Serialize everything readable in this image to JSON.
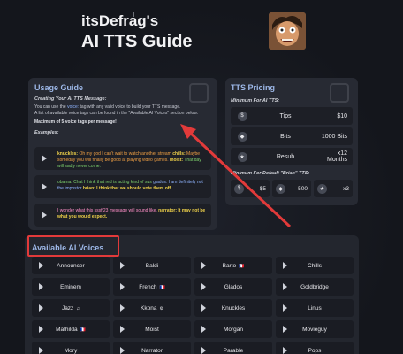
{
  "header": {
    "title_line1": "itsDefrag's",
    "title_line2": "AI TTS Guide"
  },
  "usage": {
    "title": "Usage Guide",
    "subtitle": "Creating Your AI TTS Message:",
    "p1_a": "You can use the ",
    "p1_voice": "voice:",
    "p1_b": " tag with any valid voice to build your TTS message.",
    "p2": "A list of available voice tags can be found in the \"Available AI Voices\" section below.",
    "max": "Maximum of 5 voice tags per message!",
    "examples_label": "Examples:",
    "examples": [
      {
        "segments": [
          {
            "cls": "c-yellow",
            "t": "knuckles:"
          },
          {
            "cls": "c-orange",
            "t": " Oh my god I can't wait to watch another stream "
          },
          {
            "cls": "c-yellow",
            "t": "chills:"
          },
          {
            "cls": "c-orange",
            "t": " Maybe someday you will finally be good at playing video games."
          },
          {
            "cls": "c-yellow",
            "t": " moist:"
          },
          {
            "cls": "c-green",
            "t": " That day will sadly never come."
          }
        ]
      },
      {
        "segments": [
          {
            "cls": "c-green",
            "t": "obama:"
          },
          {
            "cls": "c-green",
            "t": " Chat I think that red is acting kind of sus "
          },
          {
            "cls": "c-blue",
            "t": "glados:"
          },
          {
            "cls": "c-blue",
            "t": " I am definitely not the impostor "
          },
          {
            "cls": "c-yellow",
            "t": "brian:"
          },
          {
            "cls": "c-yellow",
            "t": " I think that we should vote them off"
          }
        ]
      },
      {
        "segments": [
          {
            "cls": "c-pink",
            "t": "I wonder what this sssff23 message will sound like. "
          },
          {
            "cls": "c-yellow",
            "t": "narrator:"
          },
          {
            "cls": "c-yellow",
            "t": " It may not be what you would expect."
          }
        ]
      }
    ]
  },
  "pricing": {
    "title": "TTS Pricing",
    "min_label": "Minimum For AI TTS:",
    "rows": [
      {
        "icon": "dollar-icon",
        "glyph": "$",
        "label": "Tips",
        "value": "$10"
      },
      {
        "icon": "diamond-icon",
        "glyph": "◆",
        "label": "Bits",
        "value": "1000 Bits"
      },
      {
        "icon": "star-icon",
        "glyph": "★",
        "label": "Resub",
        "value": "x12 Months"
      }
    ],
    "brian_label": "Minimum For Default \"Brian\" TTS:",
    "brian": [
      {
        "icon": "dollar-icon",
        "glyph": "$",
        "value": "$5"
      },
      {
        "icon": "diamond-icon",
        "glyph": "◆",
        "value": "500"
      },
      {
        "icon": "star-icon",
        "glyph": "★",
        "value": "x3"
      }
    ]
  },
  "voices": {
    "title": "Available AI Voices",
    "items": [
      {
        "name": "Announcer",
        "tag": ""
      },
      {
        "name": "Baldi",
        "tag": ""
      },
      {
        "name": "Barto",
        "tag": "🇫🇷"
      },
      {
        "name": "Chills",
        "tag": ""
      },
      {
        "name": "Eminem",
        "tag": ""
      },
      {
        "name": "French",
        "tag": "🇫🇷"
      },
      {
        "name": "Glados",
        "tag": ""
      },
      {
        "name": "Goldbridge",
        "tag": ""
      },
      {
        "name": "Jazz",
        "tag": "♫"
      },
      {
        "name": "Kkona",
        "tag": "⚙"
      },
      {
        "name": "Knuckles",
        "tag": ""
      },
      {
        "name": "Linus",
        "tag": ""
      },
      {
        "name": "Mathilda",
        "tag": "🇫🇷"
      },
      {
        "name": "Moist",
        "tag": ""
      },
      {
        "name": "Morgan",
        "tag": ""
      },
      {
        "name": "Movieguy",
        "tag": ""
      },
      {
        "name": "Mory",
        "tag": ""
      },
      {
        "name": "Narrator",
        "tag": ""
      },
      {
        "name": "Parable",
        "tag": ""
      },
      {
        "name": "Pops",
        "tag": ""
      }
    ]
  },
  "colors": {
    "accent": "#9db8e8",
    "highlight_red": "#e23a3a",
    "panel": "#272a33"
  }
}
